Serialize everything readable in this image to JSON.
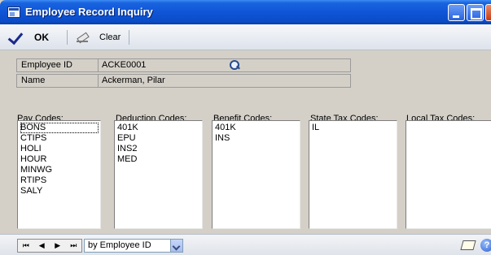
{
  "window": {
    "title": "Employee Record Inquiry"
  },
  "toolbar": {
    "ok_label": "OK",
    "clear_label": "Clear"
  },
  "form": {
    "employee_id_label": "Employee ID",
    "employee_id_value": "ACKE0001",
    "name_label": "Name",
    "name_value": "Ackerman, Pilar"
  },
  "lists": {
    "pay_codes": {
      "label": "Pay Codes:",
      "items": [
        "BONS",
        "CTIPS",
        "HOLI",
        "HOUR",
        "MINWG",
        "RTIPS",
        "SALY"
      ]
    },
    "deduction_codes": {
      "label": "Deduction Codes:",
      "items": [
        "401K",
        "EPU",
        "INS2",
        "MED"
      ]
    },
    "benefit_codes": {
      "label": "Benefit Codes:",
      "items": [
        "401K",
        "INS"
      ]
    },
    "state_tax_codes": {
      "label": "State Tax Codes:",
      "items": [
        "IL"
      ]
    },
    "local_tax_codes": {
      "label": "Local Tax Codes:",
      "items": []
    }
  },
  "navigation": {
    "first": "⏮",
    "prev": "◀",
    "next": "▶",
    "last": "⏭",
    "sort_value": "by Employee ID"
  },
  "icons": {
    "title": "window-icon",
    "ok": "checkmark-icon",
    "clear": "eraser-icon",
    "lookup": "magnifier-icon",
    "note": "note-icon",
    "help": "help-icon"
  }
}
